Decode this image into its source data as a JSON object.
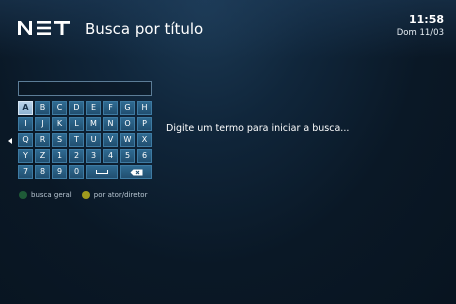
{
  "header": {
    "logo_text": "NET",
    "title": "Busca por título",
    "time": "11:58",
    "date": "Dom 11/03"
  },
  "search": {
    "value": ""
  },
  "keyboard": {
    "selected_key": "A",
    "rows": [
      [
        "A",
        "B",
        "C",
        "D",
        "E",
        "F",
        "G",
        "H"
      ],
      [
        "I",
        "J",
        "K",
        "L",
        "M",
        "N",
        "O",
        "P"
      ],
      [
        "Q",
        "R",
        "S",
        "T",
        "U",
        "V",
        "W",
        "X"
      ],
      [
        "Y",
        "Z",
        "1",
        "2",
        "3",
        "4",
        "5",
        "6"
      ],
      [
        "7",
        "8",
        "9",
        "0"
      ]
    ],
    "space_icon": "space-icon",
    "backspace_icon": "backspace-icon"
  },
  "legend": {
    "green_label": "busca geral",
    "yellow_label": "por ator/diretor"
  },
  "hint_text": "Digite um termo para iniciar a busca...",
  "colors": {
    "key": "#2a5f84",
    "key_selected": "#a9c8e3",
    "legend_green": "#1e5a37",
    "legend_yellow": "#9f9a1e"
  }
}
